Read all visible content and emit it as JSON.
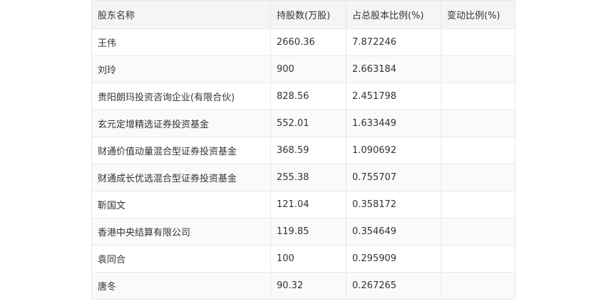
{
  "table": {
    "headers": [
      "股东名称",
      "持股数(万股)",
      "占总股本比例(%)",
      "变动比例(%)"
    ],
    "rows": [
      [
        "王伟",
        "2660.36",
        "7.872246",
        ""
      ],
      [
        "刘玲",
        "900",
        "2.663184",
        ""
      ],
      [
        "贵阳朗玛投资咨询企业(有限合伙)",
        "828.56",
        "2.451798",
        ""
      ],
      [
        "玄元定增精选证券投资基金",
        "552.01",
        "1.633449",
        ""
      ],
      [
        "财通价值动量混合型证券投资基金",
        "368.59",
        "1.090692",
        ""
      ],
      [
        "财通成长优选混合型证券投资基金",
        "255.38",
        "0.755707",
        ""
      ],
      [
        "靳国文",
        "121.04",
        "0.358172",
        ""
      ],
      [
        "香港中央结算有限公司",
        "119.85",
        "0.354649",
        ""
      ],
      [
        "袁同合",
        "100",
        "0.295909",
        ""
      ],
      [
        "唐冬",
        "90.32",
        "0.267265",
        ""
      ]
    ]
  }
}
